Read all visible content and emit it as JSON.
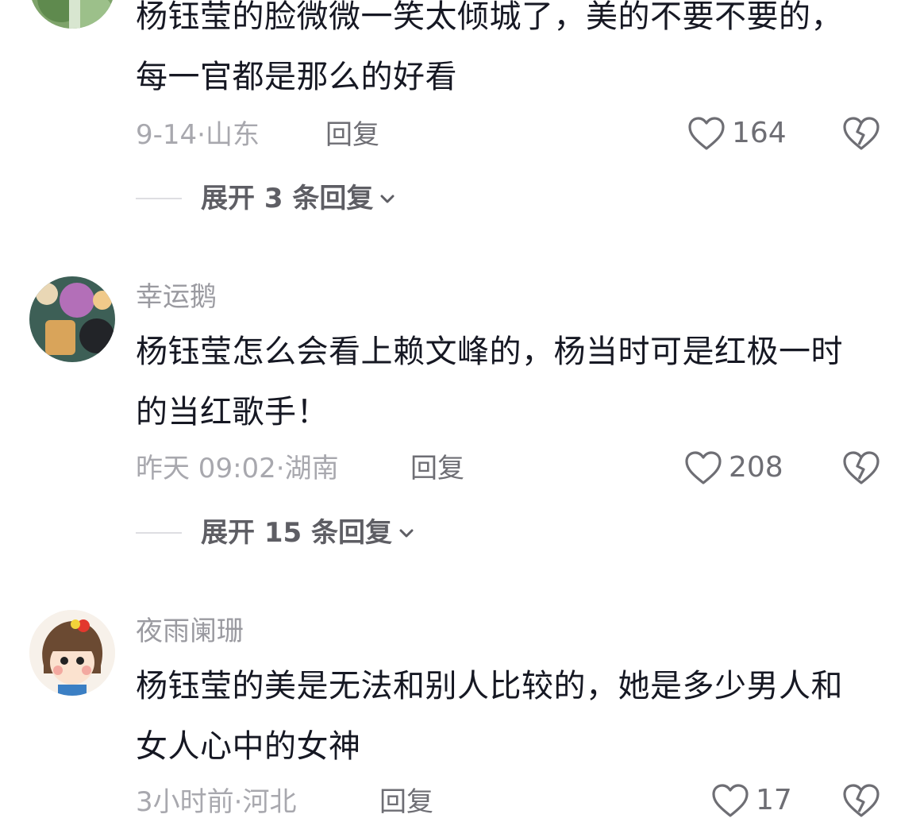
{
  "comments": [
    {
      "username": "",
      "text": "杨钰莹的脸微微一笑太倾城了，美的不要不要的，每一官都是那么的好看",
      "time": "9-14",
      "location": "山东",
      "reply_label": "回复",
      "likes": "164",
      "expand_label": "展开 3 条回复"
    },
    {
      "username": "幸运鹅",
      "text": "杨钰莹怎么会看上赖文峰的，杨当时可是红极一时的当红歌手！",
      "time": "昨天 09:02",
      "location": "湖南",
      "reply_label": "回复",
      "likes": "208",
      "expand_label": "展开 15 条回复"
    },
    {
      "username": "夜雨阑珊",
      "text": "杨钰莹的美是无法和别人比较的，她是多少男人和女人心中的女神",
      "time": "3小时前",
      "location": "河北",
      "reply_label": "回复",
      "likes": "17"
    }
  ],
  "icons": {
    "like": "heart-outline-icon",
    "dislike": "broken-heart-icon",
    "expand": "chevron-down-icon"
  }
}
